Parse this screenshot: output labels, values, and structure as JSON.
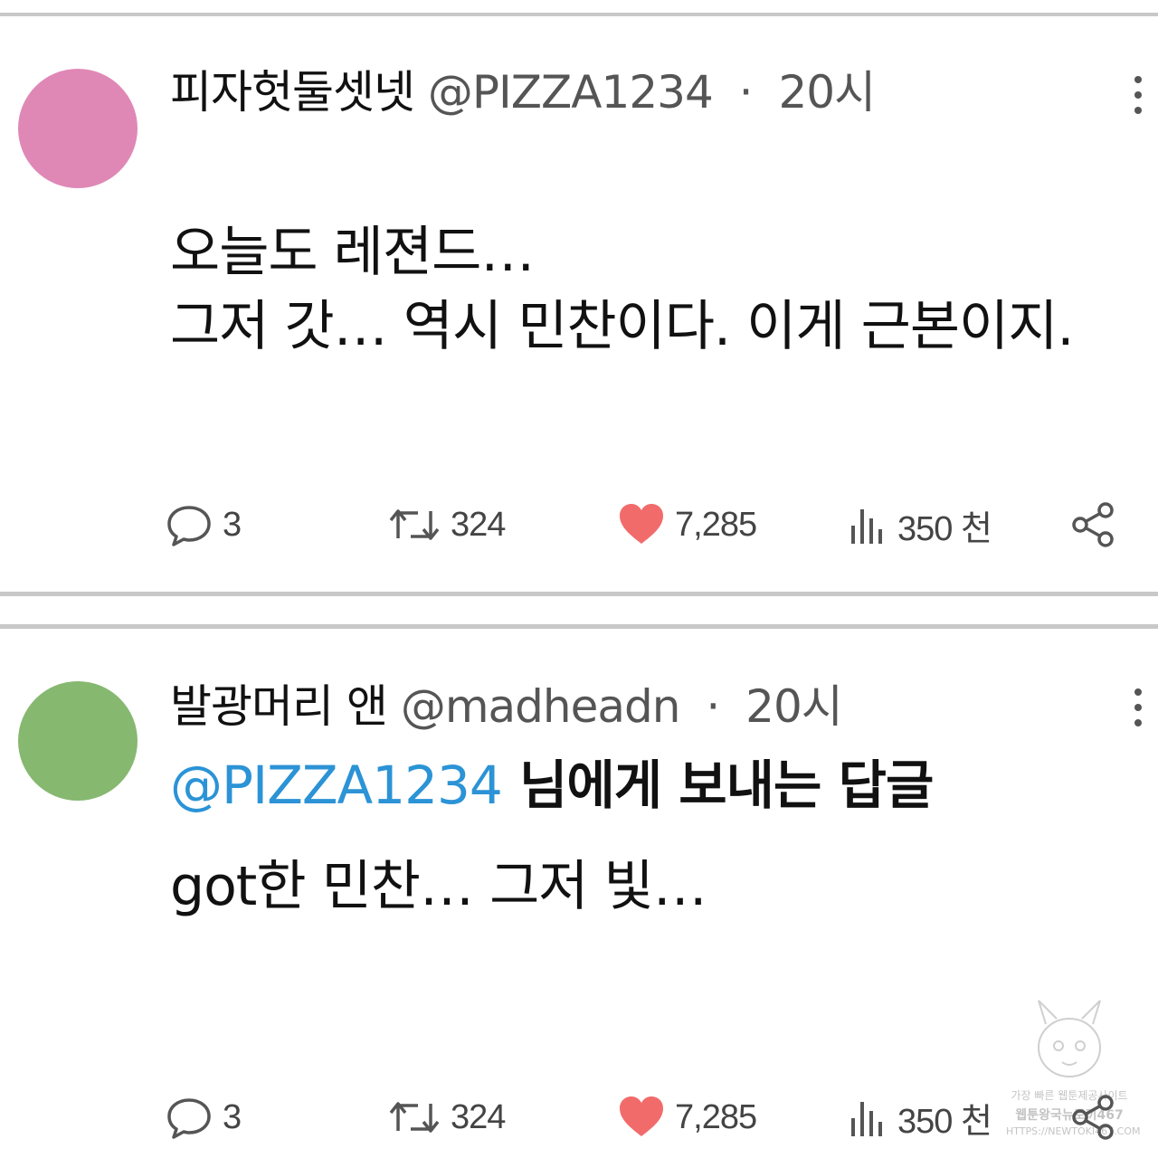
{
  "posts": [
    {
      "avatar_color": "#df88b6",
      "display_name": "피자헛둘셋넷",
      "handle": "@PIZZA1234",
      "separator": "·",
      "time": "20시",
      "body_lines": [
        "오늘도 레젼드…",
        "그저 갓… 역시 민찬이다. 이게 근본이지."
      ],
      "icons": {
        "more": "more-vertical-icon",
        "reply": "comment-icon",
        "repost": "repost-icon",
        "like": "heart-icon",
        "views": "views-icon",
        "share": "share-icon"
      },
      "stats": {
        "replies": "3",
        "reposts": "324",
        "likes": "7,285",
        "views": "350 천"
      }
    },
    {
      "avatar_color": "#86b870",
      "display_name": "발광머리 앤",
      "handle": "@madheadn",
      "separator": "·",
      "time": "20시",
      "reply_mention": "@PIZZA1234",
      "reply_suffix": " 님에게 보내는 답글",
      "body_lines": [
        "got한 민찬… 그저 빛…"
      ],
      "icons": {
        "more": "more-vertical-icon",
        "reply": "comment-icon",
        "repost": "repost-icon",
        "like": "heart-icon",
        "views": "views-icon",
        "share": "share-icon"
      },
      "stats": {
        "replies": "3",
        "reposts": "324",
        "likes": "7,285",
        "views": "350 천"
      }
    }
  ],
  "colors": {
    "like": "#f26b6b",
    "mention": "#2b93d6",
    "divider": "#c8c8c8",
    "icon": "#555555"
  },
  "watermark": {
    "lines": [
      "가장 빠른 웹툰제공사이트",
      "웹툰왕국뉴토끼467",
      "HTTPS://NEWTOKI467.COM"
    ]
  }
}
